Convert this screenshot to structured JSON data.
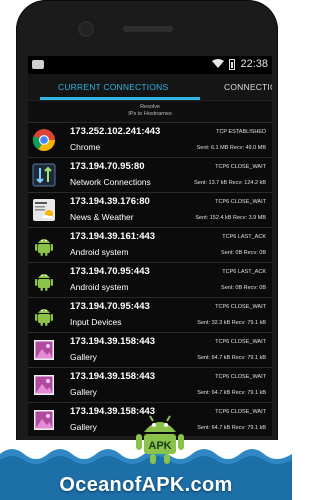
{
  "status_bar": {
    "time": "22:38"
  },
  "tabs": [
    {
      "label": "CURRENT CONNECTIONS"
    },
    {
      "label": "CONNECTIO"
    }
  ],
  "resolve": {
    "line1": "Resolve",
    "line2": "IPs to Hostnames"
  },
  "connections": [
    {
      "address": "173.252.102.241:443",
      "app": "Chrome",
      "state": "TCP ESTABLISHED",
      "traffic": "Sent: 6.1 MB  Recv: 49.0 MB",
      "icon": "chrome-icon"
    },
    {
      "address": "173.194.70.95:80",
      "app": "Network Connections",
      "state": "TCP6 CLOSE_WAIT",
      "traffic": "Sent: 13.7 kB  Recv: 124.2 kB",
      "icon": "network-connections-icon"
    },
    {
      "address": "173.194.39.176:80",
      "app": "News & Weather",
      "state": "TCP6 CLOSE_WAIT",
      "traffic": "Sent: 152.4 kB  Recv: 3.9 MB",
      "icon": "news-weather-icon"
    },
    {
      "address": "173.194.39.161:443",
      "app": "Android system",
      "state": "TCP6 LAST_ACK",
      "traffic": "Sent: 0B  Recv: 0B",
      "icon": "android-icon"
    },
    {
      "address": "173.194.70.95:443",
      "app": "Android system",
      "state": "TCP6 LAST_ACK",
      "traffic": "Sent: 0B  Recv: 0B",
      "icon": "android-icon"
    },
    {
      "address": "173.194.70.95:443",
      "app": "Input Devices",
      "state": "TCP6 CLOSE_WAIT",
      "traffic": "Sent: 32.3 kB  Recv: 79.1 kB",
      "icon": "android-icon"
    },
    {
      "address": "173.194.39.158:443",
      "app": "Gallery",
      "state": "TCP6 CLOSE_WAIT",
      "traffic": "Sent: 64.7 kB  Recv: 79.1 kB",
      "icon": "gallery-icon"
    },
    {
      "address": "173.194.39.158:443",
      "app": "Gallery",
      "state": "TCP6 CLOSE_WAIT",
      "traffic": "Sent: 64.7 kB  Recv: 79.1 kB",
      "icon": "gallery-icon"
    },
    {
      "address": "173.194.39.158:443",
      "app": "Gallery",
      "state": "TCP6 CLOSE_WAIT",
      "traffic": "Sent: 64.7 kB  Recv: 79.1 kB",
      "icon": "gallery-icon"
    }
  ],
  "watermark": {
    "text": "OceanofAPK.com",
    "logo_text": "APK"
  },
  "colors": {
    "accent": "#33b5e5",
    "watermark_blue": "#1d6fa8",
    "android_green": "#8bc34a"
  }
}
